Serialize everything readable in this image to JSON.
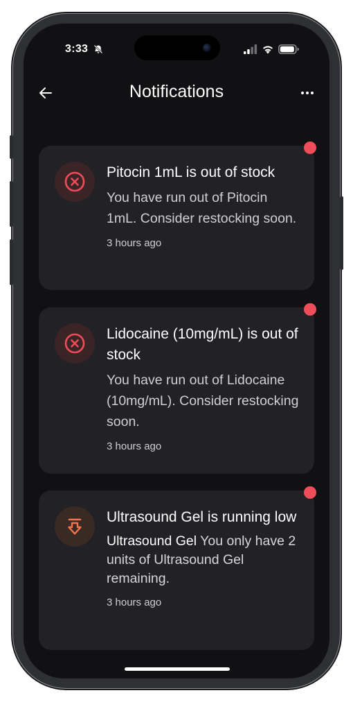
{
  "status_bar": {
    "time": "3:33"
  },
  "header": {
    "title": "Notifications"
  },
  "notifications": [
    {
      "icon": "x-circle-icon",
      "title": "Pitocin 1mL is out of stock",
      "body": "You have run out of Pitocin 1mL. Consider restocking soon.",
      "time": "3 hours ago",
      "unread": true
    },
    {
      "icon": "x-circle-icon",
      "title": "Lidocaine (10mg/mL) is out of stock",
      "body": "You have run out of Lidocaine (10mg/mL). Consider restocking soon.",
      "time": "3 hours ago",
      "unread": true
    },
    {
      "icon": "low-stock-arrow-icon",
      "title": "Ultrasound Gel is running low",
      "body_bold": "Ultrasound Gel",
      "body": "You only have 2 units of Ultrasound Gel remaining.",
      "time": "3 hours ago",
      "unread": true
    }
  ],
  "colors": {
    "background": "#111113",
    "card": "#222226",
    "unread_dot": "#ef4d59",
    "error_icon": "#ef4d59",
    "warning_icon": "#f2744a"
  }
}
